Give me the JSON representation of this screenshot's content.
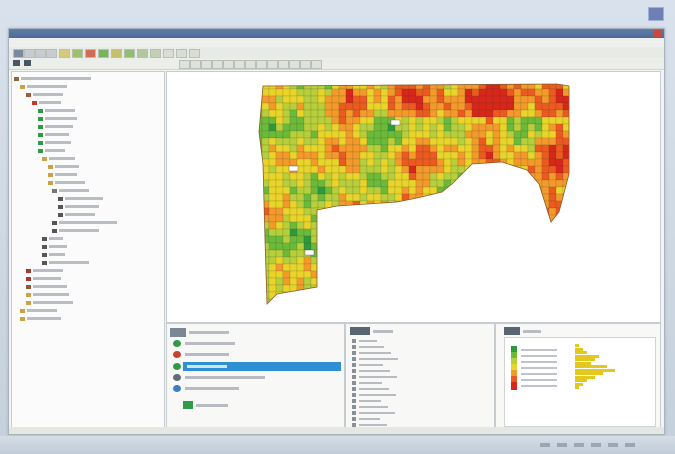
{
  "colors": {
    "accent": "#2e8fd4",
    "title_bar": "#4d6a96",
    "map_green": "#2fa33b",
    "map_red": "#e23a22",
    "map_yellow": "#e9d42a"
  },
  "icons": [
    "back-icon",
    "forward-icon",
    "close-icon",
    "folder-icon",
    "field-icon",
    "layer-icon",
    "legend-icon"
  ],
  "chart_data": {
    "type": "heatmap",
    "colorscale": [
      "#d8261b",
      "#ec5a1f",
      "#f39a2a",
      "#e9d42a",
      "#b6cf3a",
      "#6cba3a",
      "#2e9a3a"
    ],
    "histogram_values": [
      1,
      2,
      3,
      6,
      5,
      4,
      8,
      10,
      7,
      5,
      3,
      2,
      1
    ]
  }
}
